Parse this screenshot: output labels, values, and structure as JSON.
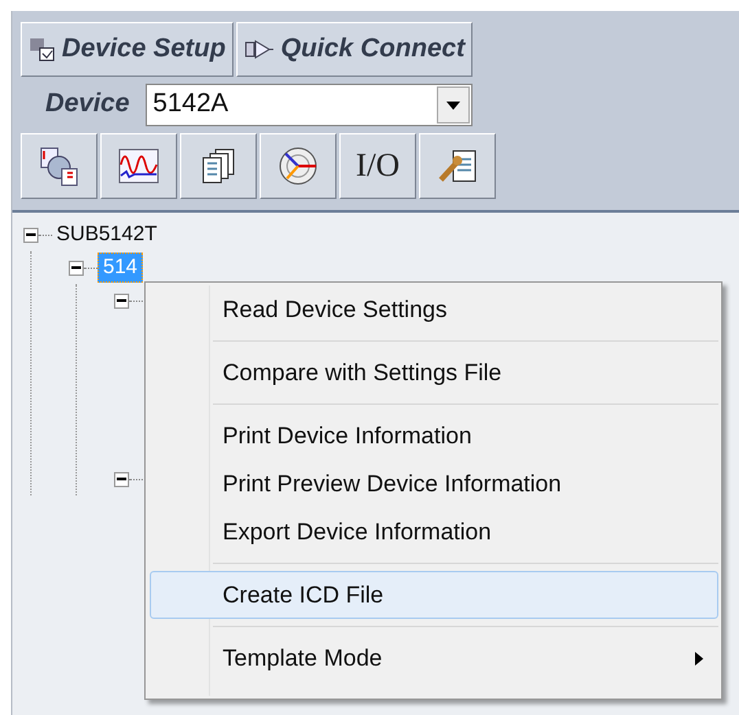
{
  "toolbar": {
    "buttons": [
      {
        "label": "Device Setup",
        "kind": "setup"
      },
      {
        "label": "Quick Connect",
        "kind": "connect"
      }
    ],
    "device": {
      "label": "Device",
      "value": "5142A"
    },
    "tools": [
      {
        "kind": "clock"
      },
      {
        "kind": "wave"
      },
      {
        "kind": "pages"
      },
      {
        "kind": "polar"
      },
      {
        "kind": "text",
        "label": "I/O"
      },
      {
        "kind": "wrench"
      }
    ]
  },
  "tree": [
    {
      "label": "SUB5142T",
      "expanded": true,
      "children": [
        {
          "label": "514",
          "selected": true,
          "expanded": true,
          "children": [
            {
              "expanded": true
            },
            {
              "expanded": true
            }
          ]
        }
      ]
    }
  ],
  "context_menu": [
    {
      "label": "Read Device Settings",
      "selected": false
    },
    {
      "kind": "separator"
    },
    {
      "label": "Compare with Settings File",
      "selected": false
    },
    {
      "kind": "separator"
    },
    {
      "label": "Print Device Information",
      "selected": false
    },
    {
      "label": "Print Preview Device Information",
      "selected": false
    },
    {
      "label": "Export Device Information",
      "selected": false
    },
    {
      "kind": "separator"
    },
    {
      "label": "Create ICD File",
      "selected": true
    },
    {
      "kind": "separator"
    },
    {
      "label": "Template Mode",
      "selected": false,
      "submenu": true
    }
  ]
}
